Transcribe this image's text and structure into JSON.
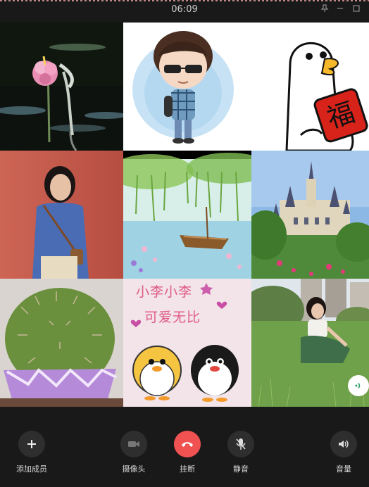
{
  "titlebar": {
    "time": "06:09",
    "pin_icon": "pin-icon",
    "minimize_icon": "minimize-icon",
    "maximize_icon": "maximize-icon"
  },
  "tiles": [
    {
      "name": "participant-lotus",
      "subject": "pink lotus flower and bird on dark water"
    },
    {
      "name": "participant-cartoon-boy",
      "subject": "cartoon boy with sunglasses"
    },
    {
      "name": "participant-goose-fu",
      "subject": "cartoon goose holding 福 card"
    },
    {
      "name": "participant-girl-red-wall",
      "subject": "girl in blue top against red wall"
    },
    {
      "name": "participant-boat-willow",
      "subject": "illustration of boat under willow"
    },
    {
      "name": "participant-castle",
      "subject": "castle with gardens"
    },
    {
      "name": "participant-cactus",
      "subject": "barrel cactus in purple pot"
    },
    {
      "name": "participant-penguins",
      "subject": "penguin stickers with text"
    },
    {
      "name": "participant-girl-grass",
      "subject": "girl sitting on grass"
    }
  ],
  "goose_card_text": "福",
  "penguin_text_line1": "小李小李",
  "penguin_text_line2": "可爱无比",
  "controls": {
    "add_member": "添加成员",
    "camera": "摄像头",
    "hangup": "挂断",
    "mute": "静音",
    "volume": "音量"
  },
  "colors": {
    "hangup": "#f05252",
    "background": "#191919",
    "button": "#2e2e2e"
  }
}
